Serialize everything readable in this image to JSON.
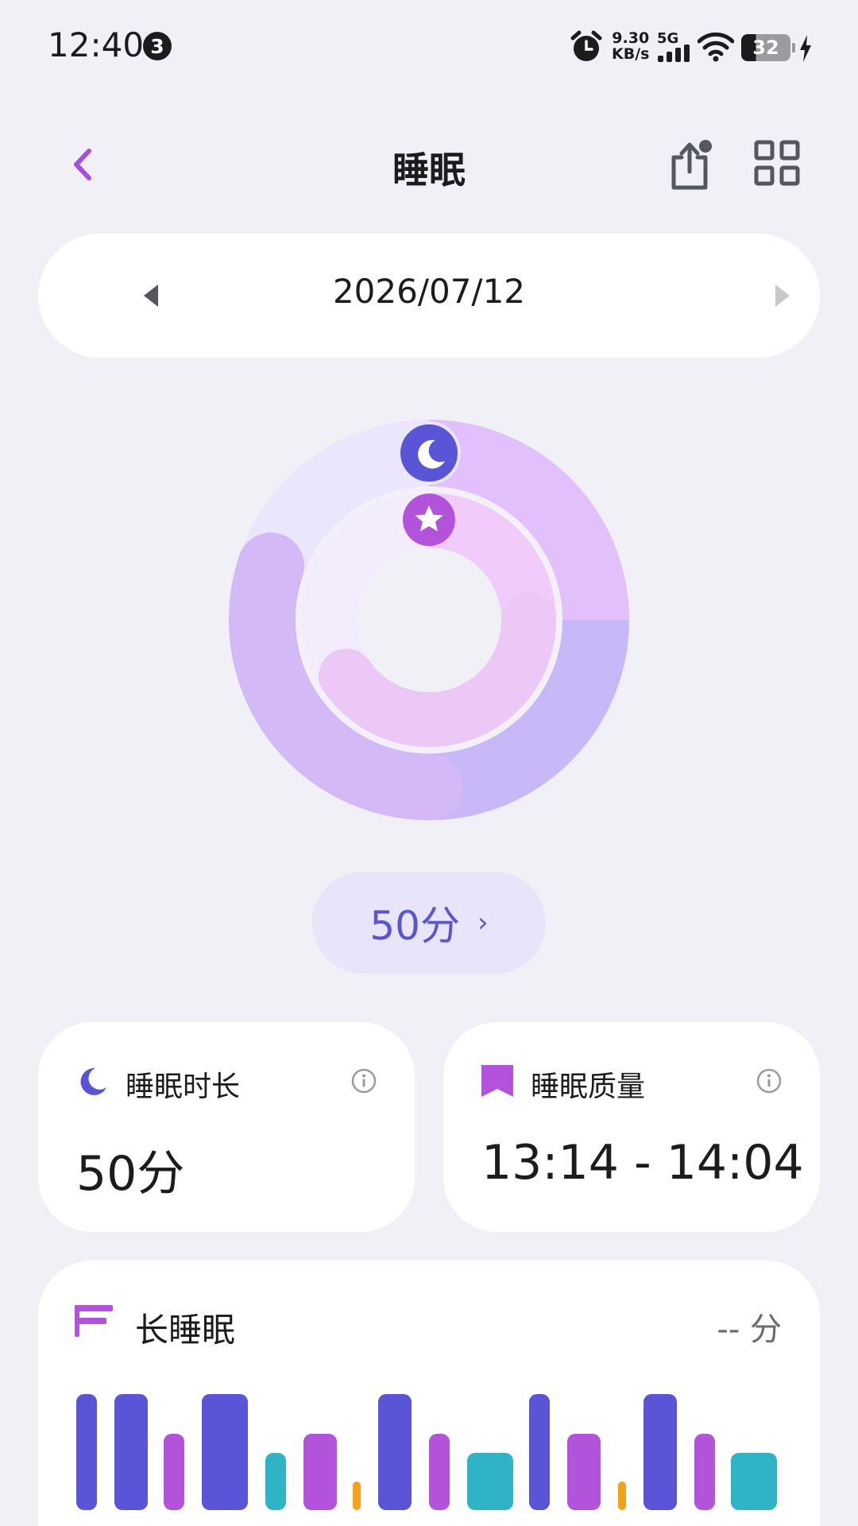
{
  "status_bar": {
    "time": "12:40",
    "notification_count": "3",
    "net_speed_value": "9.30",
    "net_speed_unit": "KB/s",
    "network_type": "5G",
    "battery_level": "32"
  },
  "header": {
    "title": "睡眠"
  },
  "date_nav": {
    "date": "2026/07/12"
  },
  "score": {
    "value": "50分",
    "chevron": "›"
  },
  "metrics": [
    {
      "label": "睡眠时长",
      "value": "50分",
      "icon": "moon-icon",
      "icon_color": "#5a55d6"
    },
    {
      "label": "睡眠质量",
      "value": "13:14 - 14:04",
      "icon": "bookmark-icon",
      "icon_color": "#b353db"
    }
  ],
  "long_sleep": {
    "title": "长睡眠",
    "value": "-- 分"
  },
  "colors": {
    "accent": "#a64fdc",
    "deep_sleep": "#5a55d6",
    "light_sleep": "#b353db",
    "rem": "#2fb3c6",
    "awake": "#f5a11c",
    "background": "#f1f0f6"
  },
  "icons": {
    "back": "back-chevron-icon",
    "share": "share-icon",
    "grid": "grid-icon",
    "date_prev": "triangle-left-icon",
    "date_next": "triangle-right-icon",
    "ring_moon": "moon-icon",
    "ring_star": "star-icon",
    "info": "info-icon"
  }
}
